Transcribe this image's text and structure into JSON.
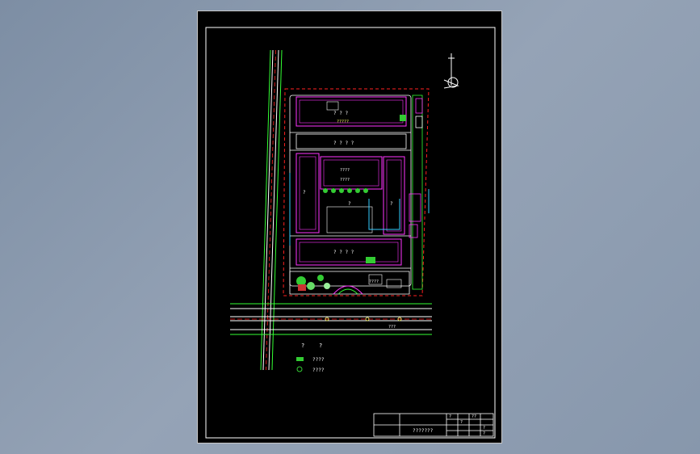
{
  "drawing": {
    "site_labels": {
      "block_a": "? ? ?",
      "block_a2": "?????",
      "block_b": "? ? ? ?",
      "hall_a": "????",
      "hall_b": "????",
      "central": "?",
      "left_wing": "?",
      "right_wing": "?",
      "south_block": "? ? ? ?",
      "gate": "????",
      "road": "???"
    },
    "legend": {
      "header_a": "?",
      "header_b": "?",
      "item_1": "????",
      "item_2": "????"
    },
    "title_block": {
      "drawing_name": "???????",
      "cell_1": "?",
      "cell_2": "??",
      "cell_3": "?",
      "cell_4": "?",
      "cell_5": "?"
    },
    "colors": {
      "background": "#000000",
      "frame": "#ffffff",
      "buildings": "#ff33ff",
      "boundary": "#ff2020",
      "roads": "#ffffff",
      "road_edge": "#33ff33",
      "water": "#33ccff",
      "green": "#33cc33"
    }
  }
}
